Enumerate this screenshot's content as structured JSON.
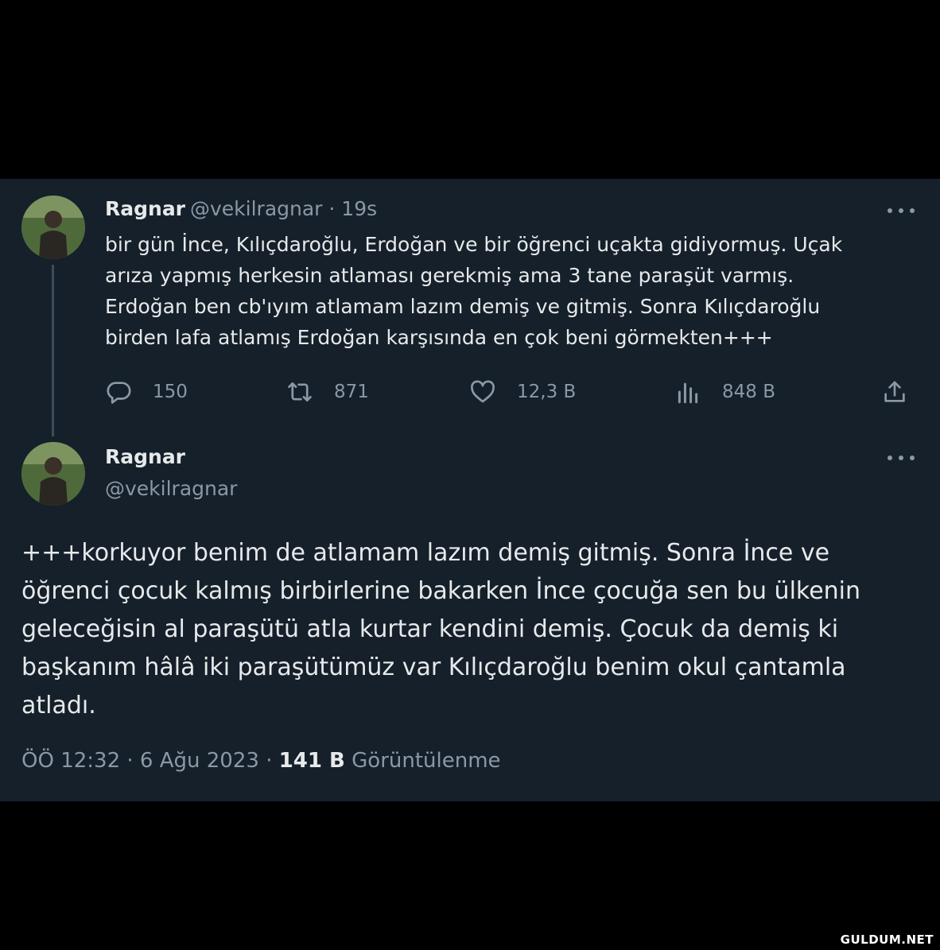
{
  "tweet1": {
    "name": "Ragnar",
    "meta": "@vekilragnar · 19s",
    "lines": [
      "bir gün İnce, Kılıçdaroğlu, Erdoğan ve bir öğrenci uçakta gidiyormuş. Uçak",
      "arıza yapmış herkesin atlaması gerekmiş ama 3 tane paraşüt varmış.",
      "Erdoğan ben cb'ıyım atlamam lazım demiş ve gitmiş. Sonra Kılıçdaroğlu",
      "birden lafa atlamış Erdoğan karşısında en çok beni görmekten+++"
    ],
    "stats": {
      "replies": "150",
      "retweets": "871",
      "likes": "12,3 B",
      "views": "848 B"
    }
  },
  "tweet2": {
    "name": "Ragnar",
    "handle": "@vekilragnar",
    "lines": [
      "+++korkuyor benim de atlamam lazım demiş gitmiş. Sonra İnce ve",
      "öğrenci çocuk kalmış birbirlerine bakarken İnce çocuğa sen bu ülkenin",
      "geleceğisin al paraşütü atla kurtar kendini demiş. Çocuk da demiş ki",
      "başkanım hâlâ iki paraşütümüz var Kılıçdaroğlu benim okul çantamla",
      "atladı."
    ],
    "time": "ÖÖ 12:32 · 6 Ağu 2023 · ",
    "views_count": "141 B",
    "views_label": " Görüntülenme"
  },
  "watermark": "GULDUM.NET",
  "colors": {
    "panel_bg": "#15202b",
    "text": "#e7e9ea",
    "muted": "#8b98a5"
  },
  "icons": [
    "avatar",
    "more-icon",
    "reply-icon",
    "retweet-icon",
    "like-icon",
    "views-icon",
    "share-icon"
  ]
}
